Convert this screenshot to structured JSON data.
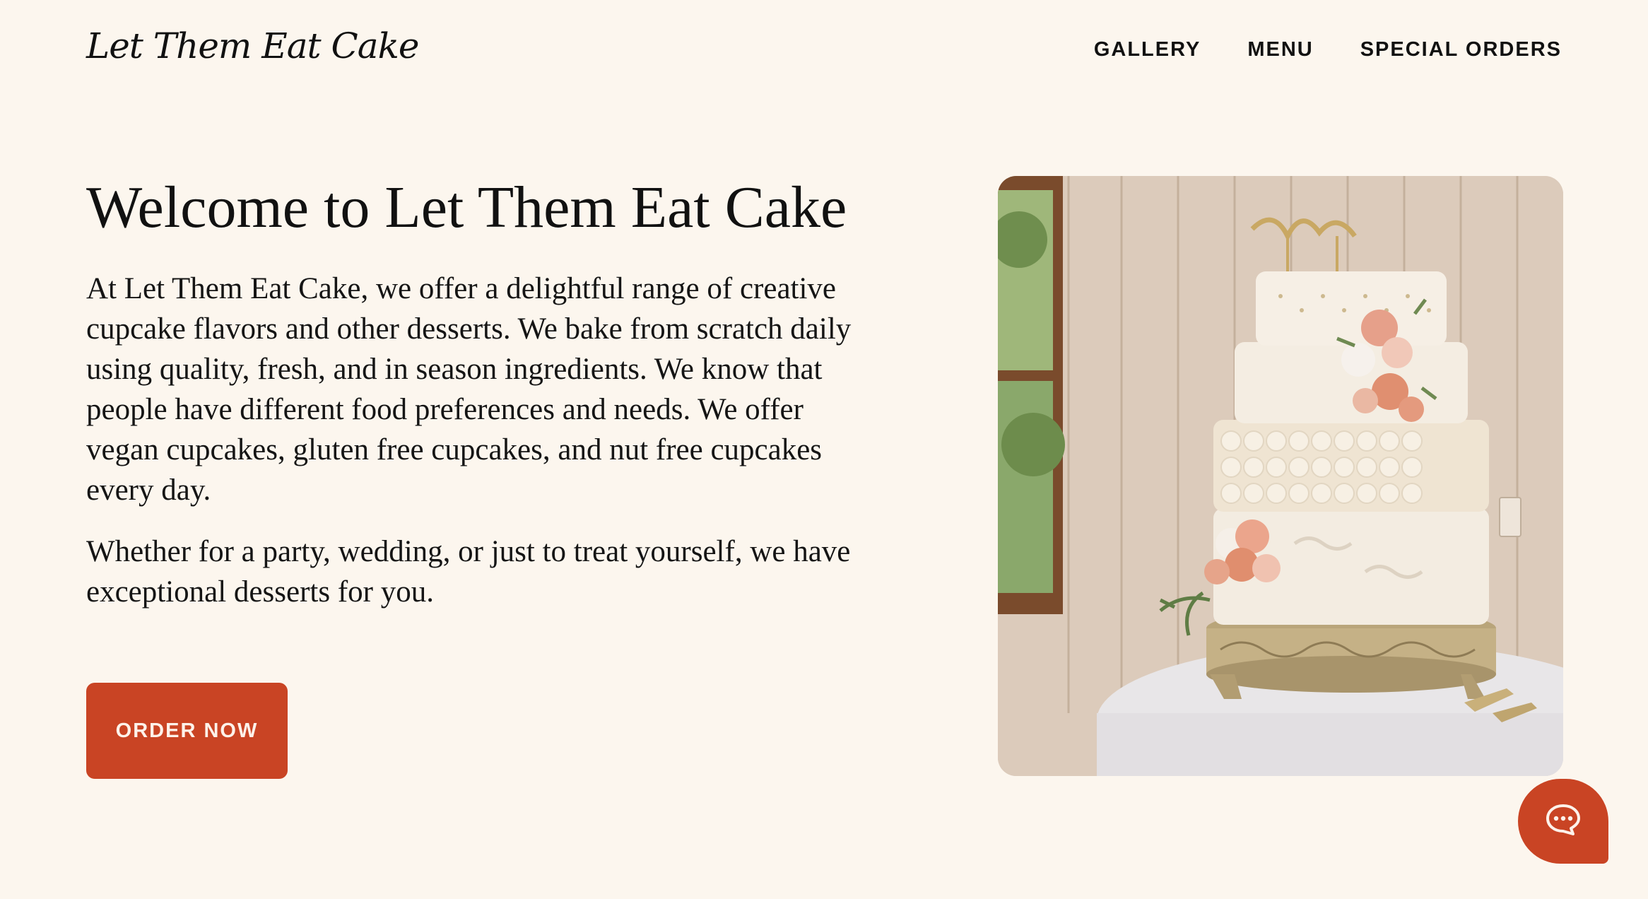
{
  "header": {
    "logo_text": "Let Them Eat Cake",
    "nav": [
      {
        "label": "GALLERY"
      },
      {
        "label": "MENU"
      },
      {
        "label": "SPECIAL ORDERS"
      }
    ]
  },
  "hero": {
    "title": "Welcome to Let Them Eat Cake",
    "paragraphs": [
      "At Let Them Eat Cake, we offer a delightful range of creative cupcake flavors and other desserts. We bake from scratch daily using quality, fresh, and in season ingredients. We know that people have different food preferences and needs. We offer vegan cupcakes, gluten free cupcakes, and nut free cupcakes every day.",
      "Whether for a party, wedding, or just to treat yourself, we have exceptional desserts for you."
    ],
    "cta_label": "ORDER NOW",
    "image_subject": "four-tier wedding cake with peach roses on gold stand"
  },
  "chat": {
    "icon": "chat-bubble-icon"
  },
  "colors": {
    "background": "#fcf6ee",
    "accent": "#c94424",
    "text": "#111111"
  }
}
